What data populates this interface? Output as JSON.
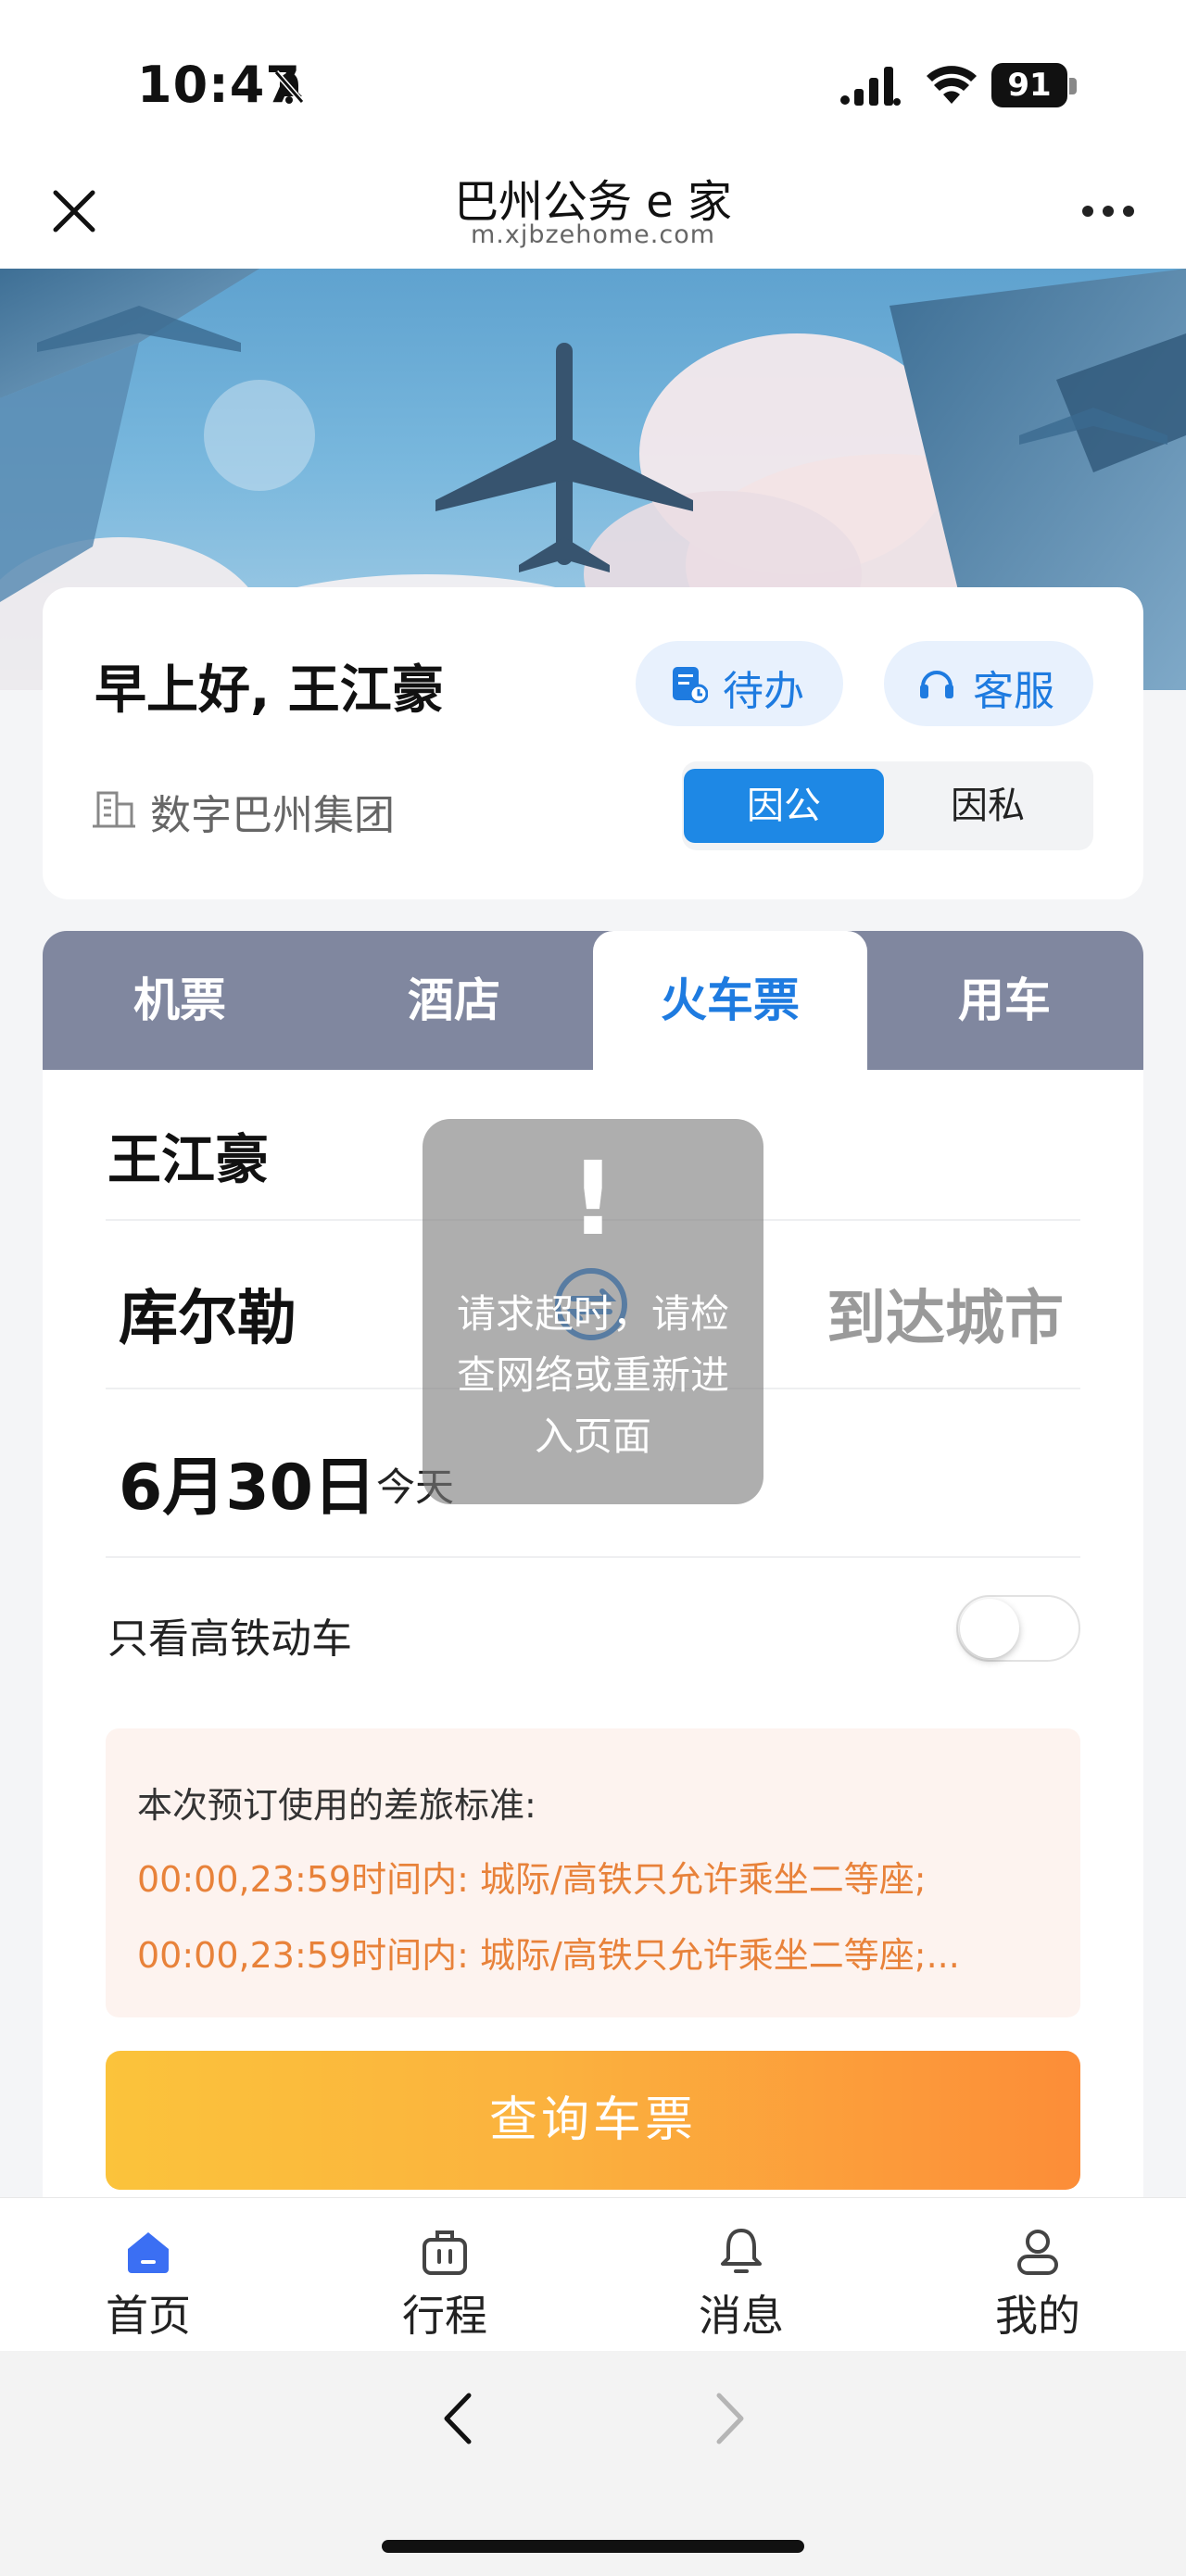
{
  "status_bar": {
    "time": "10:47",
    "battery": "91"
  },
  "header": {
    "title": "巴州公务 e 家",
    "url": "m.xjbzehome.com"
  },
  "greeting": {
    "text": "早上好, 王江豪",
    "todo_label": "待办",
    "service_label": "客服",
    "company": "数字巴州集团",
    "segment": {
      "business": "因公",
      "private": "因私",
      "selected": "因公"
    }
  },
  "tabs": [
    {
      "label": "机票"
    },
    {
      "label": "酒店"
    },
    {
      "label": "火车票",
      "active": true
    },
    {
      "label": "用车"
    }
  ],
  "form": {
    "passenger": "王江豪",
    "from_city": "库尔勒",
    "to_city_placeholder": "到达城市",
    "date": "6月30日",
    "date_hint": "今天",
    "high_speed_label": "只看高铁动车",
    "high_speed_on": false,
    "policy_title": "本次预订使用的差旅标准:",
    "policy_lines": [
      "00:00,23:59时间内: 城际/高铁只允许乘坐二等座;",
      "00:00,23:59时间内: 城际/高铁只允许乘坐二等座;..."
    ],
    "search_button": "查询车票"
  },
  "toast": {
    "icon": "!",
    "message": "请求超时，请检查网络或重新进入页面"
  },
  "bottom_nav": [
    {
      "label": "首页",
      "icon": "home-icon",
      "active": true
    },
    {
      "label": "行程",
      "icon": "suitcase-icon"
    },
    {
      "label": "消息",
      "icon": "bell-icon"
    },
    {
      "label": "我的",
      "icon": "user-icon"
    }
  ],
  "colors": {
    "accent": "#1e88e5",
    "tab_bar": "#80879f",
    "policy_text": "#e8823a",
    "button_start": "#fbc33b",
    "button_end": "#fc8d38"
  }
}
